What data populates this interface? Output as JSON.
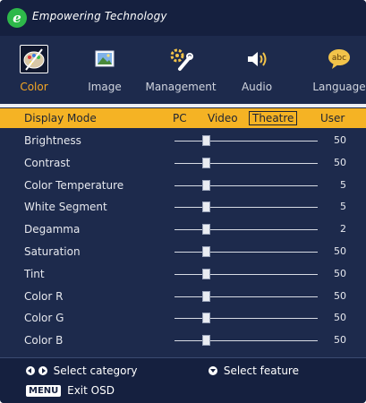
{
  "header": {
    "logo_letter": "e",
    "tagline": "Empowering Technology"
  },
  "categories": [
    {
      "label": "Color",
      "icon": "color-palette-icon",
      "selected": true
    },
    {
      "label": "Image",
      "icon": "image-icon",
      "selected": false
    },
    {
      "label": "Management",
      "icon": "management-gears-icon",
      "selected": false
    },
    {
      "label": "Audio",
      "icon": "audio-speaker-icon",
      "selected": false
    },
    {
      "label": "Language",
      "icon": "language-abc-icon",
      "selected": false
    }
  ],
  "display_mode": {
    "label": "Display Mode",
    "options": [
      "PC",
      "Video",
      "Theatre",
      "User"
    ],
    "selected": "Theatre"
  },
  "settings": [
    {
      "label": "Brightness",
      "value": "50"
    },
    {
      "label": "Contrast",
      "value": "50"
    },
    {
      "label": "Color Temperature",
      "value": "5"
    },
    {
      "label": "White Segment",
      "value": "5"
    },
    {
      "label": "Degamma",
      "value": "2"
    },
    {
      "label": "Saturation",
      "value": "50"
    },
    {
      "label": "Tint",
      "value": "50"
    },
    {
      "label": "Color R",
      "value": "50"
    },
    {
      "label": "Color G",
      "value": "50"
    },
    {
      "label": "Color B",
      "value": "50"
    }
  ],
  "footer": {
    "select_category": "Select category",
    "select_feature": "Select feature",
    "menu_key": "MENU",
    "exit": "Exit OSD"
  },
  "colors": {
    "background": "#1d2a4c",
    "highlight": "#f5b324",
    "selected_category": "#f5a623",
    "logo": "#2eb84a"
  }
}
